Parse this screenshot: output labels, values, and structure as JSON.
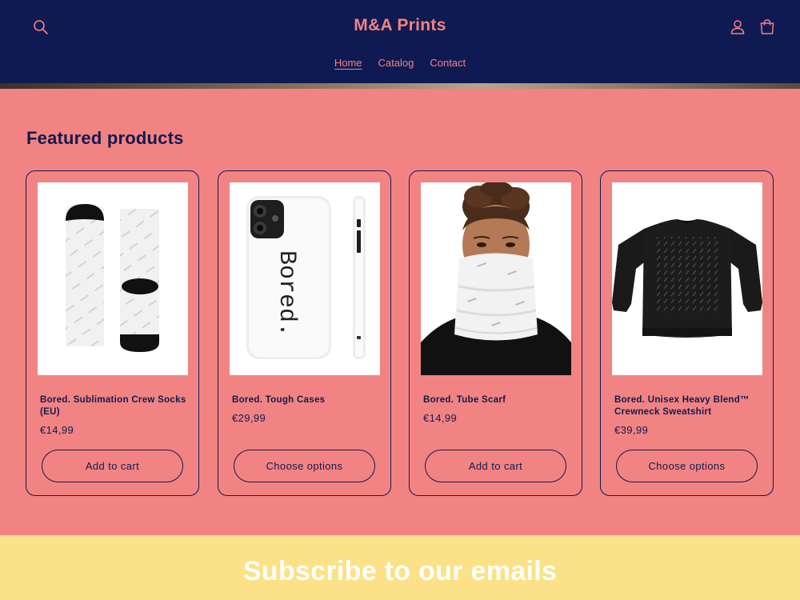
{
  "header": {
    "logo": "M&A Prints",
    "nav": [
      "Home",
      "Catalog",
      "Contact"
    ],
    "active_nav": "Home",
    "icons": {
      "search": "search-icon",
      "account": "user-icon",
      "cart": "cart-icon"
    }
  },
  "featured": {
    "title": "Featured products",
    "products": [
      {
        "name": "Bored. Sublimation Crew Socks (EU)",
        "price": "€14,99",
        "button": "Add to cart",
        "image": "white-socks-with-black-toe-and-heel"
      },
      {
        "name": "Bored. Tough Cases",
        "price": "€29,99",
        "button": "Choose options",
        "image": "white-phone-case-bored-print",
        "print_text": "Bored."
      },
      {
        "name": "Bored. Tube Scarf",
        "price": "€14,99",
        "button": "Add to cart",
        "image": "woman-wearing-white-tube-scarf"
      },
      {
        "name": "Bored. Unisex Heavy Blend™ Crewneck Sweatshirt",
        "price": "€39,99",
        "button": "Choose options",
        "image": "black-crewneck-sweatshirt"
      }
    ]
  },
  "newsletter": {
    "title": "Subscribe to our emails"
  },
  "colors": {
    "header_bg": "#0f1a52",
    "accent": "#f28383",
    "text": "#121a4e",
    "newsletter_bg": "#fbe288"
  }
}
